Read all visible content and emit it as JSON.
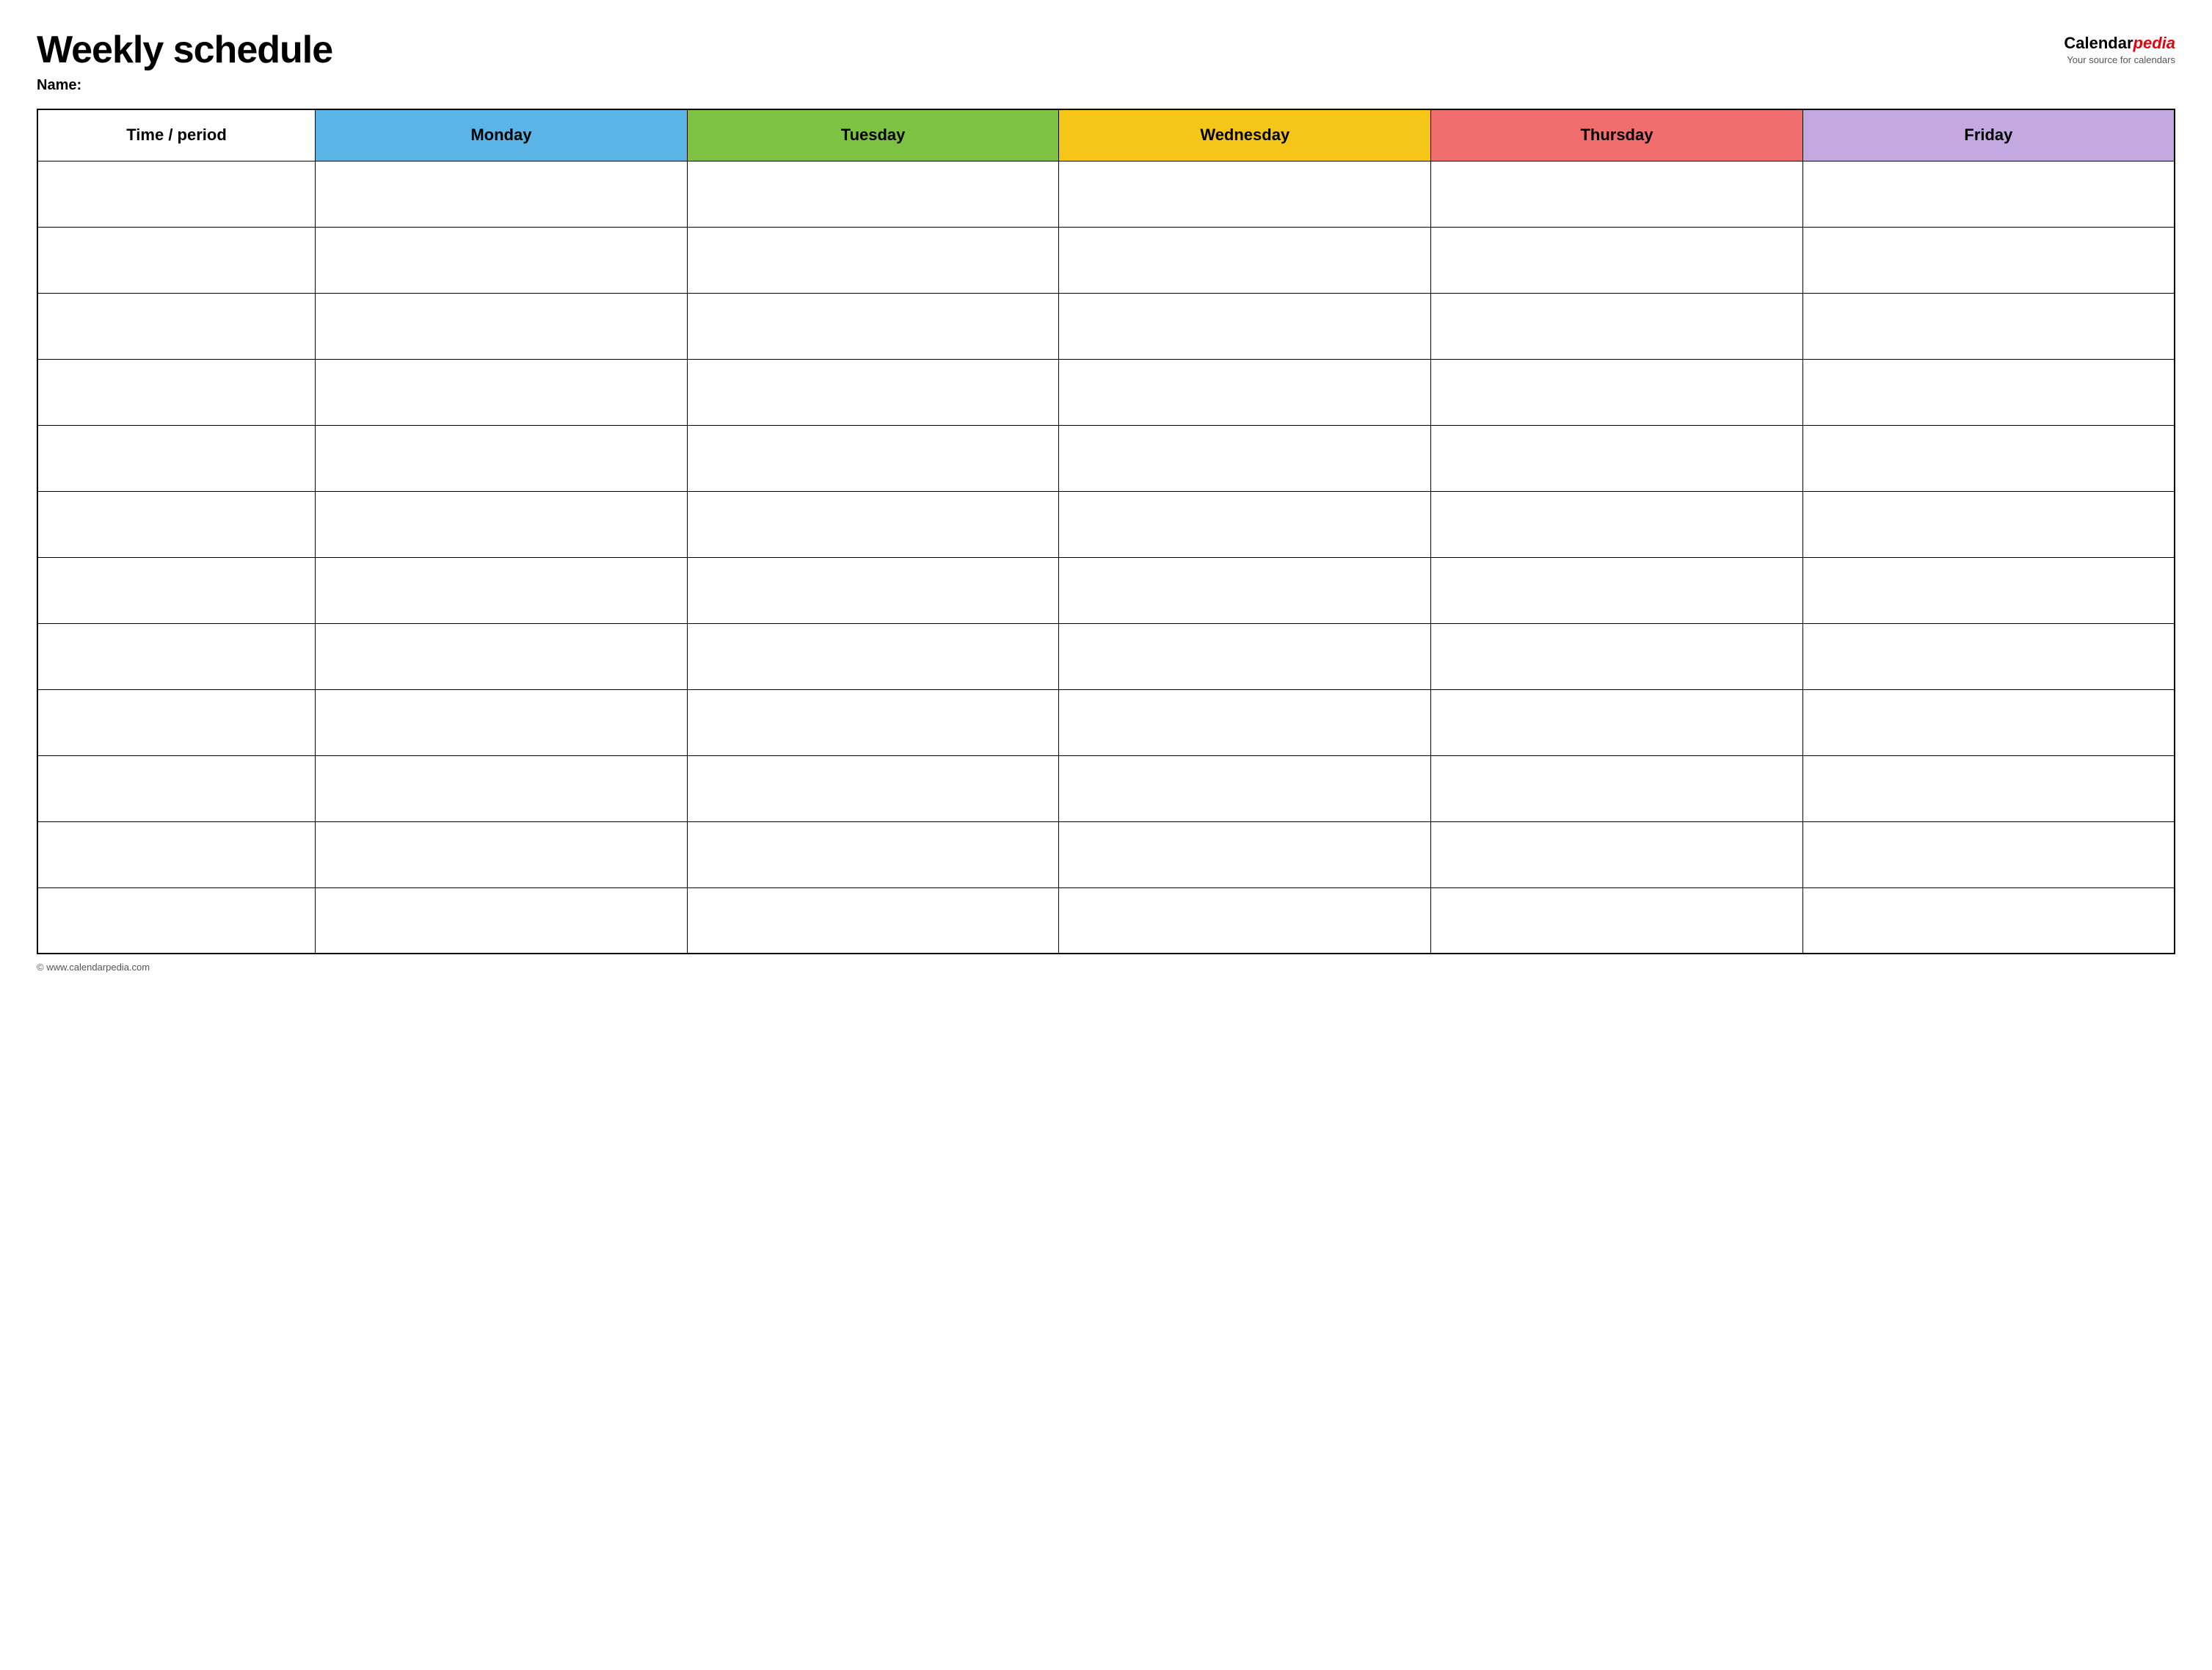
{
  "header": {
    "title": "Weekly schedule",
    "name_label": "Name:",
    "logo_text": "Calendar",
    "logo_italic": "pedia",
    "logo_tagline": "Your source for calendars"
  },
  "table": {
    "columns": [
      {
        "id": "time",
        "label": "Time / period",
        "color": "#ffffff"
      },
      {
        "id": "monday",
        "label": "Monday",
        "color": "#5ab4e5"
      },
      {
        "id": "tuesday",
        "label": "Tuesday",
        "color": "#7dc242"
      },
      {
        "id": "wednesday",
        "label": "Wednesday",
        "color": "#f5c518"
      },
      {
        "id": "thursday",
        "label": "Thursday",
        "color": "#f06e6e"
      },
      {
        "id": "friday",
        "label": "Friday",
        "color": "#c4a8e0"
      }
    ],
    "row_count": 12
  },
  "footer": {
    "url": "© www.calendarpedia.com"
  }
}
